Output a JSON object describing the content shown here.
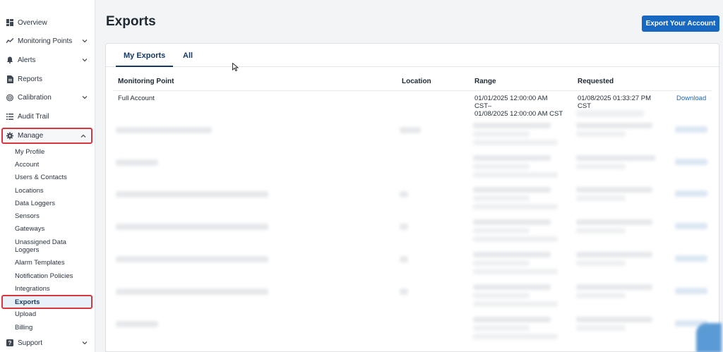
{
  "sidebar": {
    "items": [
      {
        "label": "Overview",
        "icon": "grid-icon"
      },
      {
        "label": "Monitoring Points",
        "icon": "trend-icon"
      },
      {
        "label": "Alerts",
        "icon": "bell-icon"
      },
      {
        "label": "Reports",
        "icon": "document-icon"
      },
      {
        "label": "Calibration",
        "icon": "target-icon"
      },
      {
        "label": "Audit Trail",
        "icon": "list-icon"
      },
      {
        "label": "Manage",
        "icon": "gear-icon"
      }
    ],
    "manage_subitems": [
      "My Profile",
      "Account",
      "Users & Contacts",
      "Locations",
      "Data Loggers",
      "Sensors",
      "Gateways",
      "Unassigned Data Loggers",
      "Alarm Templates",
      "Notification Policies",
      "Integrations",
      "Exports",
      "Upload",
      "Billing"
    ],
    "support": {
      "label": "Support",
      "icon": "question-icon"
    }
  },
  "header": {
    "title": "Exports",
    "export_button": "Export Your Account"
  },
  "tabs": [
    "My Exports",
    "All"
  ],
  "table": {
    "columns": [
      "Monitoring Point",
      "Location",
      "Range",
      "Requested"
    ],
    "first_row": {
      "monitoring_point": "Full Account",
      "location": "",
      "range_line1": "01/01/2025 12:00:00 AM",
      "range_line2": "CST–",
      "range_line3": "01/08/2025 12:00:00 AM CST",
      "requested_line1": "01/08/2025 01:33:27 PM",
      "requested_line2": "CST",
      "action": "Download"
    }
  },
  "colors": {
    "accent": "#1668c1",
    "highlight": "#d9363e",
    "nav_text": "#15375f"
  }
}
